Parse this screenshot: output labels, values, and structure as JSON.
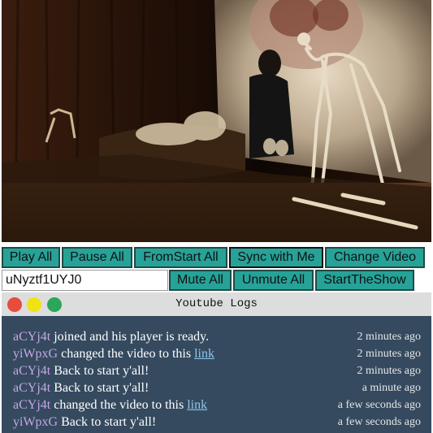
{
  "video": {
    "id": "uNyztf1UYJ0"
  },
  "controls": {
    "play_all": "Play All",
    "pause_all": "Pause All",
    "from_start_all": "FromStart All",
    "sync_with_me": "Sync with Me",
    "change_video": "Change Video",
    "mute_all": "Mute All",
    "unmute_all": "Unmute All",
    "start_the_show": "StartTheShow"
  },
  "video_input": {
    "value": "uNyztf1UYJ0"
  },
  "logs": {
    "title": "Youtube Logs",
    "entries": [
      {
        "user": "aCYj4t",
        "text": " joined and his player is ready.",
        "link": "",
        "time": "2 minutes ago"
      },
      {
        "user": "yiWpxG",
        "text": " changed the video to this ",
        "link": "link",
        "time": "2 minutes ago"
      },
      {
        "user": "aCYj4t",
        "text": " Back to start y'all!",
        "link": "",
        "time": "2 minutes ago"
      },
      {
        "user": "aCYj4t",
        "text": " Back to start y'all!",
        "link": "",
        "time": "a minute ago"
      },
      {
        "user": "aCYj4t",
        "text": " changed the video to this ",
        "link": "link",
        "time": "a few seconds ago"
      },
      {
        "user": "yiWpxG",
        "text": " Back to start y'all!",
        "link": "",
        "time": "a few seconds ago"
      }
    ]
  },
  "colors": {
    "button": "#27a298",
    "log_background": "#354a5f",
    "username": "#c7a6e6",
    "link": "#8ec6ea"
  }
}
